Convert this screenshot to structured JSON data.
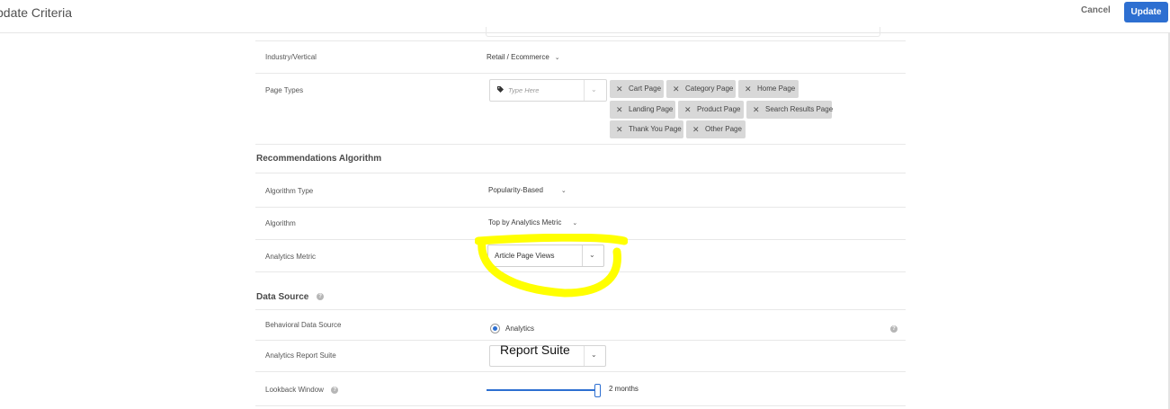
{
  "header": {
    "title": "pdate Criteria",
    "cancel_label": "Cancel",
    "update_label": "Update"
  },
  "industry": {
    "label": "Industry/Vertical",
    "value": "Retail / Ecommerce"
  },
  "page_types": {
    "label": "Page Types",
    "placeholder": "Type Here",
    "tags": [
      "Cart Page",
      "Category Page",
      "Home Page",
      "Landing Page",
      "Product Page",
      "Search Results Page",
      "Thank You Page",
      "Other Page"
    ]
  },
  "algorithm_section": {
    "title": "Recommendations Algorithm",
    "type_label": "Algorithm Type",
    "type_value": "Popularity-Based",
    "algorithm_label": "Algorithm",
    "algorithm_value": "Top by Analytics Metric",
    "metric_label": "Analytics Metric",
    "metric_value": "Article Page Views"
  },
  "data_source": {
    "title": "Data Source",
    "behavioral_label": "Behavioral Data Source",
    "behavioral_value": "Analytics",
    "report_suite_label": "Analytics Report Suite",
    "report_suite_overlay": "Report Suite",
    "lookback_label": "Lookback Window",
    "lookback_value": "2 months",
    "lookback_fraction": 1.0
  },
  "colors": {
    "accent": "#2d6fd1",
    "highlight": "#ffff00"
  },
  "icons": {
    "tag": "tag-icon",
    "remove": "close-icon",
    "dropdown": "chevron-down-icon",
    "help": "help-icon"
  }
}
